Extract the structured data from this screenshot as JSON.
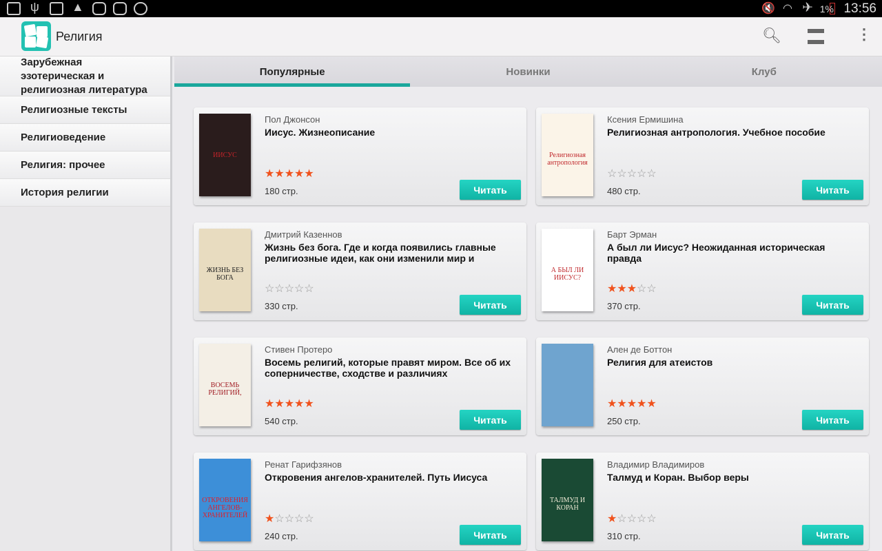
{
  "status_bar": {
    "battery": "1%",
    "time": "13:56",
    "icons": [
      "mail-icon",
      "usb-icon",
      "screen-rotate-icon",
      "warning-icon",
      "gallery-icon",
      "gallery-icon",
      "app-icon"
    ]
  },
  "app_bar": {
    "title": "Религия"
  },
  "sidebar": {
    "items": [
      {
        "label": "Зарубежная эзотерическая и религиозная литература"
      },
      {
        "label": "Религиозные тексты"
      },
      {
        "label": "Религиоведение"
      },
      {
        "label": "Религия: прочее"
      },
      {
        "label": "История религии"
      }
    ]
  },
  "tabs": [
    {
      "label": "Популярные",
      "active": true
    },
    {
      "label": "Новинки"
    },
    {
      "label": "Клуб"
    }
  ],
  "read_label": "Читать",
  "books": [
    {
      "author": "Пол Джонсон",
      "title": "Иисус. Жизнеописание",
      "rating": 5,
      "pages": "180 стр.",
      "cover_color": "#2a1c1c",
      "cover_text": "ИИСУС",
      "cover_text_color": "#c8242a"
    },
    {
      "author": "Ксения Ермишина",
      "title": "Религиозная антропология. Учебное пособие",
      "rating": 0,
      "pages": "480 стр.",
      "cover_color": "#fbf4e8",
      "cover_text": "Религиозная антропология",
      "cover_text_color": "#c0282c"
    },
    {
      "author": "Дмитрий Казеннов",
      "title": "Жизнь без бога. Где и когда появились главные религиозные идеи, как они изменили мир и",
      "rating": 0,
      "pages": "330 стр.",
      "cover_color": "#e8dcc0",
      "cover_text": "ЖИЗНЬ БЕЗ БОГА",
      "cover_text_color": "#222"
    },
    {
      "author": "Барт Эрман",
      "title": "А был ли Иисус? Неожиданная историческая правда",
      "rating": 3,
      "pages": "370 стр.",
      "cover_color": "#ffffff",
      "cover_text": "А БЫЛ ЛИ ИИСУС?",
      "cover_text_color": "#c0282c"
    },
    {
      "author": "Стивен Протеро",
      "title": "Восемь религий, которые правят миром. Все об их соперничестве, сходстве и различиях",
      "rating": 5,
      "pages": "540 стр.",
      "cover_color": "#f4efe6",
      "cover_text": "ВОСЕМЬ РЕЛИГИЙ,",
      "cover_text_color": "#a01a22"
    },
    {
      "author": "Ален де Боттон",
      "title": "Религия для атеистов",
      "rating": 5,
      "pages": "250 стр.",
      "cover_color": "#6fa4cf",
      "cover_text": "",
      "cover_text_color": "#fff"
    },
    {
      "author": "Ренат Гарифзянов",
      "title": "Откровения ангелов-хранителей. Путь Иисуса",
      "rating": 1,
      "pages": "240 стр.",
      "cover_color": "#3d8fd8",
      "cover_text": "ОТКРОВЕНИЯ АНГЕЛОВ-ХРАНИТЕЛЕЙ",
      "cover_text_color": "#e0202a"
    },
    {
      "author": "Владимир Владимиров",
      "title": "Талмуд и Коран. Выбор веры",
      "rating": 1,
      "pages": "310 стр.",
      "cover_color": "#1a4a34",
      "cover_text": "ТАЛМУД И КОРАН",
      "cover_text_color": "#f2ecd8"
    }
  ],
  "colors": {
    "accent": "#1aa79c",
    "button": "#16c0b0",
    "star": "#f0521d"
  }
}
